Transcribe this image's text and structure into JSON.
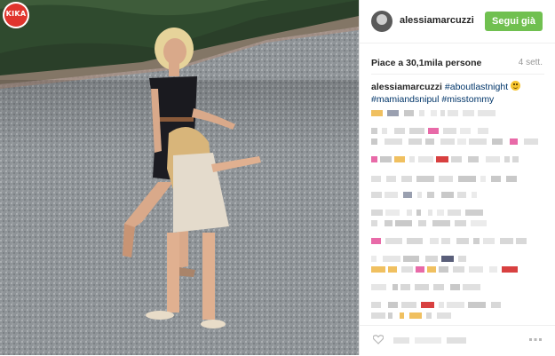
{
  "brand": {
    "logo_text": "KIKA"
  },
  "post": {
    "username": "alessiamarcuzzi",
    "follow_label": "Segui già",
    "likes_text": "Piace a 30,1mila persone",
    "age_text": "4 sett.",
    "caption": {
      "username": "alessiamarcuzzi",
      "hashtags": [
        "#aboutlastnight",
        "#mamiandsnipul",
        "#misstommy"
      ],
      "emoji": "smiling-face-icon"
    }
  },
  "colors": {
    "follow_button": "#70c050",
    "hashtag": "#003569",
    "logo": "#e0342d"
  }
}
